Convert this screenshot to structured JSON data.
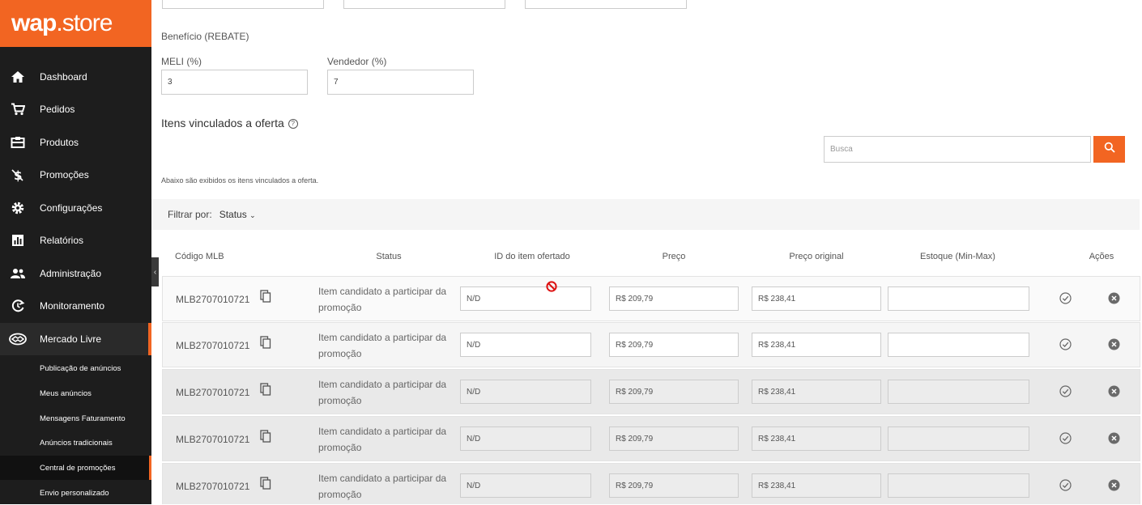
{
  "brand": {
    "name_bold": "wap",
    "name_rest": ".store"
  },
  "sidebar": {
    "items": [
      {
        "label": "Dashboard",
        "icon": "home-icon"
      },
      {
        "label": "Pedidos",
        "icon": "cart-icon"
      },
      {
        "label": "Produtos",
        "icon": "box-icon"
      },
      {
        "label": "Promoções",
        "icon": "dollar-icon"
      },
      {
        "label": "Configurações",
        "icon": "gear-icon"
      },
      {
        "label": "Relatórios",
        "icon": "bar-chart-icon"
      },
      {
        "label": "Administração",
        "icon": "users-icon"
      },
      {
        "label": "Monitoramento",
        "icon": "monitor-icon"
      },
      {
        "label": "Mercado Livre",
        "icon": "handshake-icon"
      }
    ],
    "subitems": [
      {
        "label": "Publicação de anúncios"
      },
      {
        "label": "Meus anúncios"
      },
      {
        "label": "Mensagens Faturamento"
      },
      {
        "label": "Anúncios tradicionais"
      },
      {
        "label": "Central de promoções"
      },
      {
        "label": "Envio personalizado"
      }
    ]
  },
  "rebate": {
    "title": "Benefício (REBATE)",
    "meli_label": "MELI (%)",
    "meli_value": "3",
    "vendor_label": "Vendedor (%)",
    "vendor_value": "7"
  },
  "items_section": {
    "title": "Itens vinculados a oferta",
    "help_icon": "?",
    "description": "Abaixo são exibidos os itens vinculados a oferta.",
    "search_placeholder": "Busca",
    "filter_label": "Filtrar por:",
    "filter_value": "Status"
  },
  "table": {
    "headers": {
      "code": "Código MLB",
      "status": "Status",
      "item_id": "ID do item ofertado",
      "price": "Preço",
      "original_price": "Preço original",
      "stock": "Estoque (Min-Max)",
      "actions": "Ações"
    },
    "rows": [
      {
        "code": "MLB2707010721",
        "status": "Item candidato a participar da promoção",
        "item_id": "N/D",
        "price": "R$ 209,79",
        "original_price": "R$ 238,41",
        "stock": ""
      },
      {
        "code": "MLB2707010721",
        "status": "Item candidato a participar da promoção",
        "item_id": "N/D",
        "price": "R$ 209,79",
        "original_price": "R$ 238,41",
        "stock": ""
      },
      {
        "code": "MLB2707010721",
        "status": "Item candidato a participar da promoção",
        "item_id": "N/D",
        "price": "R$ 209,79",
        "original_price": "R$ 238,41",
        "stock": ""
      },
      {
        "code": "MLB2707010721",
        "status": "Item candidato a participar da promoção",
        "item_id": "N/D",
        "price": "R$ 209,79",
        "original_price": "R$ 238,41",
        "stock": ""
      },
      {
        "code": "MLB2707010721",
        "status": "Item candidato a participar da promoção",
        "item_id": "N/D",
        "price": "R$ 209,79",
        "original_price": "R$ 238,41",
        "stock": ""
      }
    ]
  },
  "colors": {
    "accent": "#f26522",
    "sidebar_bg": "#1d1d1d",
    "row_shade": "#e9e9e9"
  }
}
